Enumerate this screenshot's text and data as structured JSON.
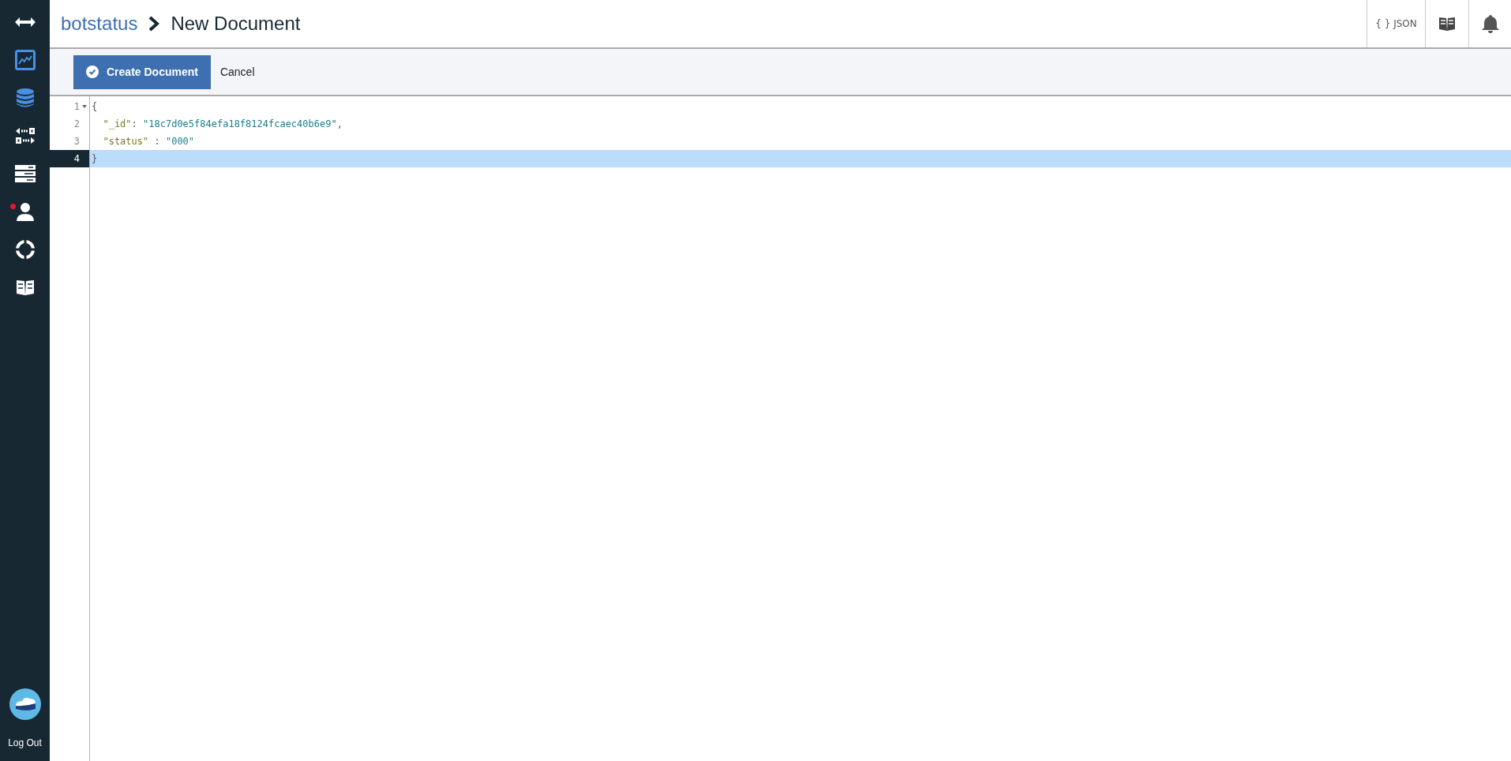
{
  "sidebar": {
    "items": [
      {
        "kind": "expand"
      },
      {
        "kind": "chart"
      },
      {
        "kind": "database"
      },
      {
        "kind": "replication"
      },
      {
        "kind": "servers"
      },
      {
        "kind": "user",
        "alert": true
      },
      {
        "kind": "support"
      },
      {
        "kind": "docs"
      }
    ],
    "logout": "Log Out"
  },
  "header": {
    "breadcrumb": "botstatus",
    "title": "New Document",
    "json_button": "{ } JSON"
  },
  "toolbar": {
    "create_button": "Create Document",
    "cancel_button": "Cancel"
  },
  "editor": {
    "lines": [
      {
        "number": "1",
        "fold": true,
        "active": false,
        "tokens": [
          {
            "kind": "punct",
            "text": "{"
          }
        ]
      },
      {
        "number": "2",
        "fold": false,
        "active": false,
        "tokens": [
          {
            "kind": "key",
            "text": "  \"_id\""
          },
          {
            "kind": "punct",
            "text": ": "
          },
          {
            "kind": "string",
            "text": "\"18c7d0e5f84efa18f8124fcaec40b6e9\""
          },
          {
            "kind": "punct",
            "text": ","
          }
        ]
      },
      {
        "number": "3",
        "fold": false,
        "active": false,
        "tokens": [
          {
            "kind": "key",
            "text": "  \"status\""
          },
          {
            "kind": "punct",
            "text": " : "
          },
          {
            "kind": "string",
            "text": "\"000\""
          }
        ]
      },
      {
        "number": "4",
        "fold": false,
        "active": true,
        "tokens": [
          {
            "kind": "punct",
            "text": "}"
          }
        ]
      }
    ]
  }
}
